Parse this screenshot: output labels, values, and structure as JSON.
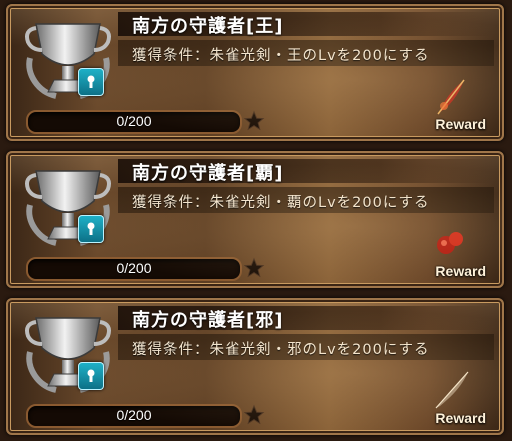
{
  "achievements": [
    {
      "title": "南方の守護者[王]",
      "condition": "獲得条件：朱雀光剣・王のLvを200にする",
      "progress_text": "0/200",
      "progress_fraction": 0,
      "reward_label": "Reward",
      "reward_icon": "red-feather-icon"
    },
    {
      "title": "南方の守護者[覇]",
      "condition": "獲得条件：朱雀光剣・覇のLvを200にする",
      "progress_text": "0/200",
      "progress_fraction": 0,
      "reward_label": "Reward",
      "reward_icon": "red-gem-icon"
    },
    {
      "title": "南方の守護者[邪]",
      "condition": "獲得条件：朱雀光剣・邪のLvを200にする",
      "progress_text": "0/200",
      "progress_fraction": 0,
      "reward_label": "Reward",
      "reward_icon": "quill-feather-icon"
    }
  ],
  "colors": {
    "frame": "#a0764a",
    "lock": "#1ab0c8",
    "text": "#ffffff"
  }
}
